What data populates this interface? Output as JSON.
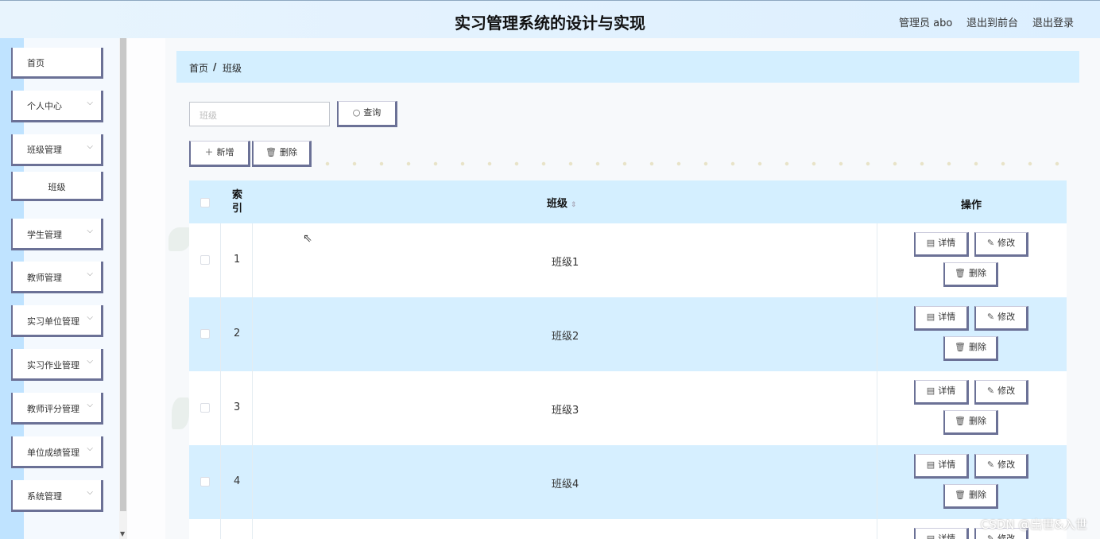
{
  "header": {
    "title": "实习管理系统的设计与实现",
    "user_label": "管理员 abo",
    "to_front": "退出到前台",
    "logout": "退出登录"
  },
  "sidebar": {
    "items": [
      {
        "label": "首页"
      },
      {
        "label": "个人中心"
      },
      {
        "label": "班级管理"
      },
      {
        "label": "班级"
      },
      {
        "label": "学生管理"
      },
      {
        "label": "教师管理"
      },
      {
        "label": "实习单位管理"
      },
      {
        "label": "实习作业管理"
      },
      {
        "label": "教师评分管理"
      },
      {
        "label": "单位成绩管理"
      },
      {
        "label": "系统管理"
      }
    ]
  },
  "breadcrumb": {
    "home": "首页",
    "sep": "/",
    "current": "班级"
  },
  "search": {
    "placeholder": "班级",
    "button": "查询"
  },
  "toolbar": {
    "add": "新增",
    "delete": "删除"
  },
  "table": {
    "headers": {
      "index": "索\n引",
      "name": "班级",
      "ops": "操作"
    },
    "rows": [
      {
        "index": "1",
        "name": "班级1"
      },
      {
        "index": "2",
        "name": "班级2"
      },
      {
        "index": "3",
        "name": "班级3"
      },
      {
        "index": "4",
        "name": "班级4"
      }
    ],
    "ops": {
      "detail": "详情",
      "edit": "修改",
      "delete": "删除"
    },
    "partial_ops": {
      "detail": "详情",
      "edit": "修改"
    }
  },
  "watermark": "CSDN @出世&入世",
  "colors": {
    "accent_border": "#6b7196",
    "header_bg": "#d4efff"
  }
}
